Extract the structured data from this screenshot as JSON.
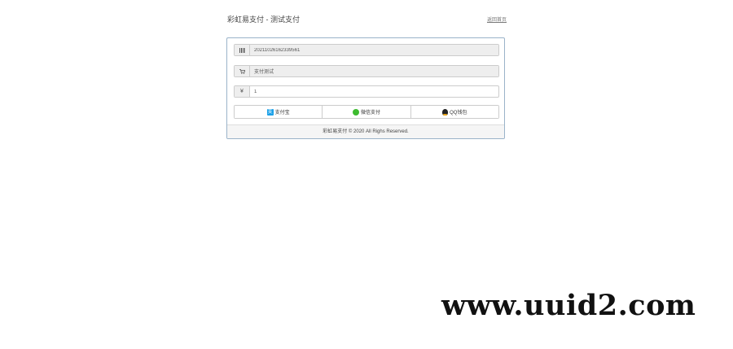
{
  "header": {
    "title": "彩虹易支付 - 测试支付",
    "home_link": "返回首页"
  },
  "form": {
    "order_no": {
      "icon": "barcode-icon",
      "value": "20211026162339561"
    },
    "product_name": {
      "icon": "cart-icon",
      "value": "支付测试"
    },
    "amount": {
      "icon": "yuan-icon",
      "symbol": "¥",
      "value": "1"
    }
  },
  "payment_methods": [
    {
      "label": "支付宝",
      "icon": "alipay-icon"
    },
    {
      "label": "微信支付",
      "icon": "wechat-icon"
    },
    {
      "label": "QQ钱包",
      "icon": "qq-icon"
    }
  ],
  "footer": {
    "text": "彩虹易支付 © 2020 All Righs Reserved."
  },
  "watermark": {
    "text": "www.uuid2.com"
  },
  "colors": {
    "panel_border": "#9ab3c9",
    "alipay": "#1aa0e8",
    "wechat": "#3dbb2f"
  }
}
